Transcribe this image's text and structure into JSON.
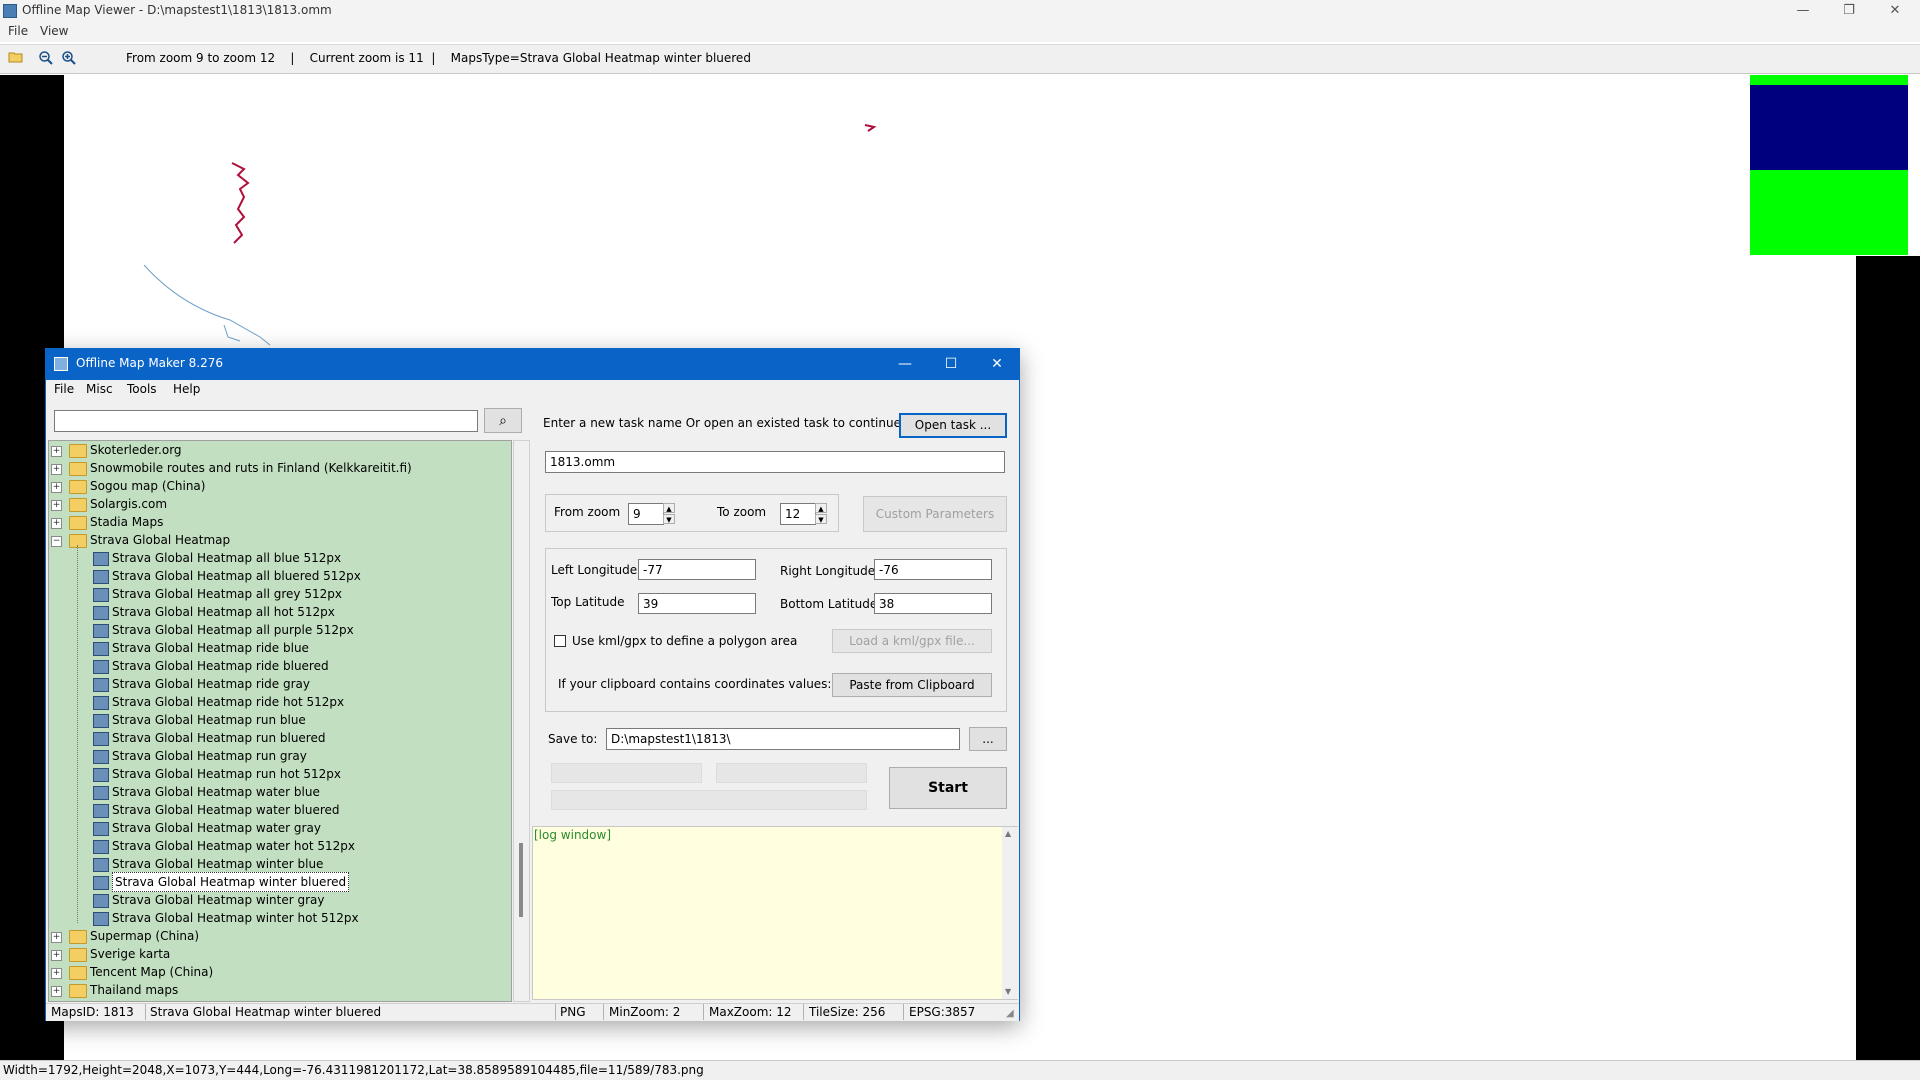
{
  "viewer": {
    "title": "Offline Map Viewer - D:\\mapstest1\\1813\\1813.omm",
    "menu": [
      "File",
      "View"
    ],
    "toolbar_status": "From zoom 9 to zoom 12    |    Current zoom is 11  |    MapsType=Strava Global Heatmap winter bluered",
    "statusbar": "Width=1792,Height=2048,X=1073,Y=444,Long=-76.4311981201172,Lat=38.8589589104485,file=11/589/783.png",
    "window_controls": {
      "minimize": "—",
      "restore": "❐",
      "close": "✕"
    },
    "legend_colors": {
      "navy": "#00007f",
      "green": "#00ff00"
    }
  },
  "dialog": {
    "title": "Offline Map Maker 8.276",
    "menu": [
      "File",
      "Misc",
      "Tools",
      "Help"
    ],
    "search_placeholder": "",
    "tree": [
      {
        "label": "Skoterleder.org",
        "type": "folder",
        "expanded": false
      },
      {
        "label": "Snowmobile routes and ruts in Finland (Kelkkareitit.fi)",
        "type": "folder",
        "expanded": false
      },
      {
        "label": "Sogou map (China)",
        "type": "folder",
        "expanded": false
      },
      {
        "label": "Solargis.com",
        "type": "folder",
        "expanded": false
      },
      {
        "label": "Stadia Maps",
        "type": "folder",
        "expanded": false
      },
      {
        "label": "Strava Global Heatmap",
        "type": "folder",
        "expanded": true
      },
      {
        "label": "Strava Global Heatmap all blue 512px",
        "type": "map"
      },
      {
        "label": "Strava Global Heatmap all bluered 512px",
        "type": "map"
      },
      {
        "label": "Strava Global Heatmap all grey 512px",
        "type": "map"
      },
      {
        "label": "Strava Global Heatmap all hot 512px",
        "type": "map"
      },
      {
        "label": "Strava Global Heatmap all purple 512px",
        "type": "map"
      },
      {
        "label": "Strava Global Heatmap ride blue",
        "type": "map"
      },
      {
        "label": "Strava Global Heatmap ride bluered",
        "type": "map"
      },
      {
        "label": "Strava Global Heatmap ride gray",
        "type": "map"
      },
      {
        "label": "Strava Global Heatmap ride hot 512px",
        "type": "map"
      },
      {
        "label": "Strava Global Heatmap run blue",
        "type": "map"
      },
      {
        "label": "Strava Global Heatmap run bluered",
        "type": "map"
      },
      {
        "label": "Strava Global Heatmap run gray",
        "type": "map"
      },
      {
        "label": "Strava Global Heatmap run hot 512px",
        "type": "map"
      },
      {
        "label": "Strava Global Heatmap water blue",
        "type": "map"
      },
      {
        "label": "Strava Global Heatmap water bluered",
        "type": "map"
      },
      {
        "label": "Strava Global Heatmap water gray",
        "type": "map"
      },
      {
        "label": "Strava Global Heatmap water hot 512px",
        "type": "map"
      },
      {
        "label": "Strava Global Heatmap winter blue",
        "type": "map"
      },
      {
        "label": "Strava Global Heatmap winter bluered",
        "type": "map",
        "selected": true
      },
      {
        "label": "Strava Global Heatmap winter gray",
        "type": "map"
      },
      {
        "label": "Strava Global Heatmap winter hot 512px",
        "type": "map"
      },
      {
        "label": "Supermap (China)",
        "type": "folder",
        "expanded": false
      },
      {
        "label": "Sverige karta",
        "type": "folder",
        "expanded": false
      },
      {
        "label": "Tencent Map (China)",
        "type": "folder",
        "expanded": false
      },
      {
        "label": "Thailand maps",
        "type": "folder",
        "expanded": false
      }
    ],
    "task_prompt": "Enter a new task name Or open an existed task to continue:",
    "open_task_label": "Open task ...",
    "task_name": "1813.omm",
    "from_zoom_label": "From zoom",
    "from_zoom_value": "9",
    "to_zoom_label": "To zoom",
    "to_zoom_value": "12",
    "custom_params_label": "Custom Parameters",
    "left_lon_label": "Left Longitude",
    "left_lon_value": "-77",
    "right_lon_label": "Right Longitude",
    "right_lon_value": "-76",
    "top_lat_label": "Top Latitude",
    "top_lat_value": "39",
    "bottom_lat_label": "Bottom Latitude",
    "bottom_lat_value": "38",
    "kml_checkbox_label": "Use kml/gpx to define a polygon area",
    "load_kml_label": "Load a kml/gpx file...",
    "clipboard_prompt": "If your clipboard contains coordinates values:",
    "paste_label": "Paste from Clipboard",
    "save_to_label": "Save to:",
    "save_to_value": "D:\\mapstest1\\1813\\",
    "browse_label": "...",
    "start_label": "Start",
    "log_text": "[log window]",
    "statusbar": {
      "maps_id": "MapsID: 1813",
      "maps_name": "Strava Global Heatmap winter bluered",
      "format": "PNG",
      "min_zoom": "MinZoom: 2",
      "max_zoom": "MaxZoom: 12",
      "tile_size": "TileSize: 256",
      "epsg": "EPSG:3857"
    }
  }
}
